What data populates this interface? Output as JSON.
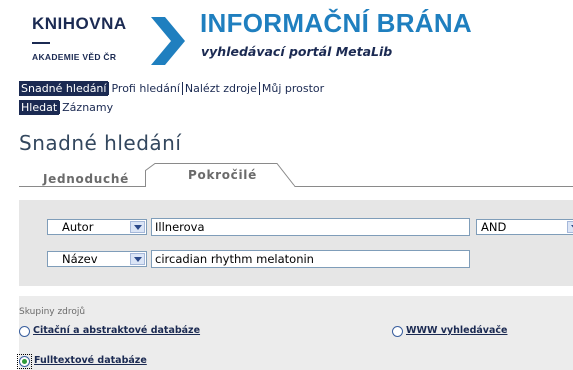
{
  "header": {
    "library_name": "KNIHOVNA",
    "library_subtitle": "AKADEMIE VĚD ČR",
    "portal_title": "INFORMAČNÍ BRÁNA",
    "portal_subtitle": "vyhledávací portál MetaLib"
  },
  "nav": {
    "primary": [
      "Snadné hledání",
      "Profi hledání",
      "Nalézt zdroje",
      "Můj prostor"
    ],
    "secondary": [
      "Hledat",
      "Záznamy"
    ]
  },
  "page_title": "Snadné hledání",
  "tabs": [
    "Jednoduché",
    "Pokročilé"
  ],
  "search": {
    "row1": {
      "field": "Autor",
      "value": "Illnerova",
      "operator": "AND"
    },
    "row2": {
      "field": "Název",
      "value": "circadian rhythm melatonin"
    }
  },
  "groups": {
    "label": "Skupiny zdrojů",
    "options": [
      {
        "label": "Citační a abstraktové databáze",
        "checked": false
      },
      {
        "label": "WWW vyhledávače",
        "checked": false
      },
      {
        "label": "Fulltextové databáze",
        "checked": true
      }
    ]
  },
  "colors": {
    "navy": "#1b2a52",
    "brand_blue": "#1f7fbf",
    "panel_gray": "#e6e6e6"
  }
}
